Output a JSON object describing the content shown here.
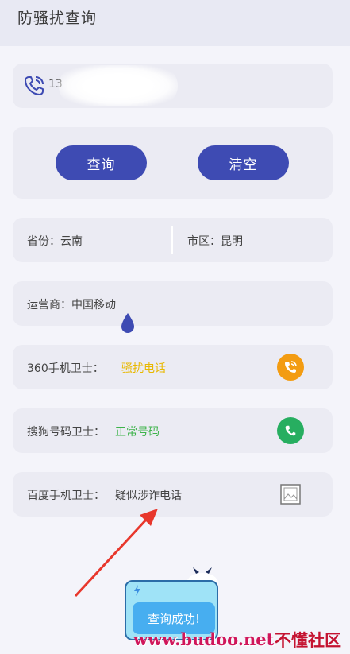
{
  "header": {
    "title": "防骚扰查询"
  },
  "phone": {
    "prefix": "13"
  },
  "buttons": {
    "query_label": "查询",
    "clear_label": "清空"
  },
  "region": {
    "province_label": "省份：云南",
    "city_label": "市区：昆明"
  },
  "carrier": {
    "label": "运营商：中国移动"
  },
  "guards": [
    {
      "name": "360手机卫士：",
      "value": "骚扰电话",
      "icon": "orange-phone-icon",
      "color": "#e8b800"
    },
    {
      "name": "搜狗号码卫士：",
      "value": "正常号码",
      "icon": "green-phone-icon",
      "color": "#3db34a"
    },
    {
      "name": "百度手机卫士：",
      "value": "疑似涉诈电话",
      "icon": "image-icon",
      "color": "#444444"
    }
  ],
  "toast": {
    "message": "查询成功!"
  },
  "watermark": {
    "url": "www.budoo.net",
    "brand": "不懂社区"
  },
  "colors": {
    "accent": "#3e4bb3",
    "card": "#ebebf3",
    "background": "#f4f4fa"
  }
}
